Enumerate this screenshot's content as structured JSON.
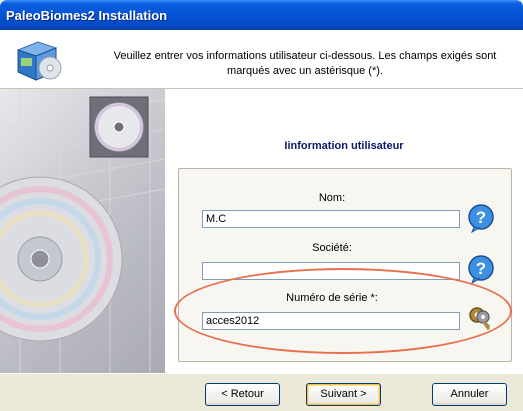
{
  "window": {
    "title": "PaleoBiomes2 Installation"
  },
  "header": {
    "instruction": "Veuillez entrer vos informations utilisateur ci-dessous. Les champs exigés sont marqués avec un astérisque (*)."
  },
  "section": {
    "title": "Iinformation utilisateur"
  },
  "form": {
    "name_label": "Nom:",
    "name_value": "M.C",
    "company_label": "Société:",
    "company_value": "",
    "serial_label": "Numéro de série *:",
    "serial_value": "acces2012"
  },
  "buttons": {
    "back": "< Retour",
    "next": "Suivant >",
    "cancel": "Annuler"
  },
  "colors": {
    "titlebar": "#0553d8",
    "highlight_ellipse": "#e8704e",
    "section_title": "#0a1a6a"
  }
}
